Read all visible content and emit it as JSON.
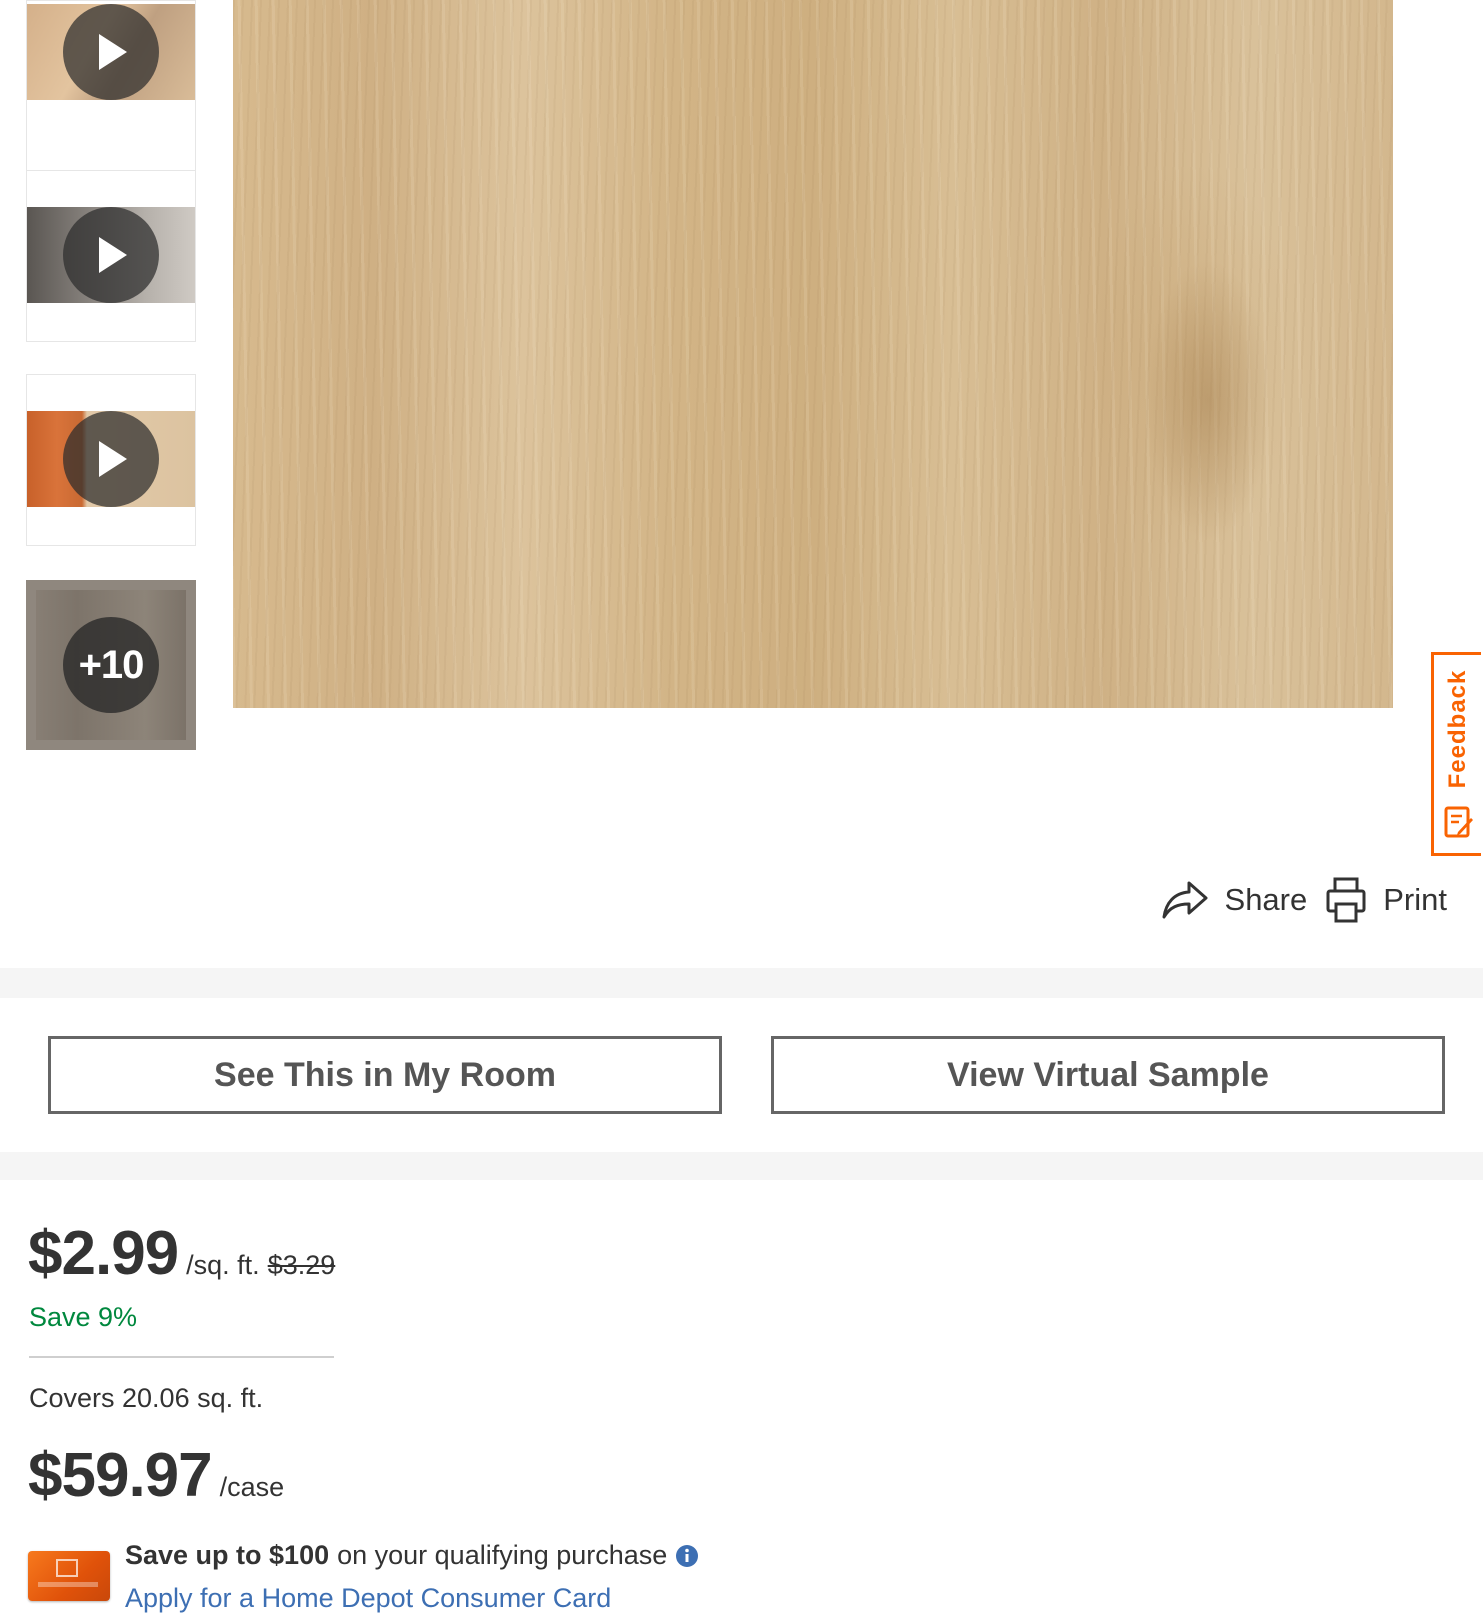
{
  "gallery": {
    "more_count": "+10",
    "thumbnails": [
      {
        "type": "video",
        "icon": "play-icon"
      },
      {
        "type": "video",
        "icon": "play-icon"
      },
      {
        "type": "video",
        "icon": "play-icon"
      },
      {
        "type": "more"
      }
    ]
  },
  "feedback": {
    "label": "Feedback",
    "color": "#f96302"
  },
  "actions": {
    "share_label": "Share",
    "print_label": "Print"
  },
  "ar_buttons": {
    "see_in_room": "See This in My Room",
    "virtual_sample": "View Virtual Sample"
  },
  "pricing": {
    "price": "$2.99",
    "unit": "/sq. ft.",
    "was_price": "$3.29",
    "savings": "Save 9%",
    "coverage": "Covers 20.06 sq. ft.",
    "case_price": "$59.97",
    "case_unit": "/case"
  },
  "promo": {
    "bold_text": "Save up to $100",
    "text": "on your qualifying purchase",
    "link_text": "Apply for a Home Depot Consumer Card"
  },
  "colors": {
    "accent": "#f96302",
    "savings_green": "#00883e",
    "link_blue": "#3d6fb3"
  }
}
